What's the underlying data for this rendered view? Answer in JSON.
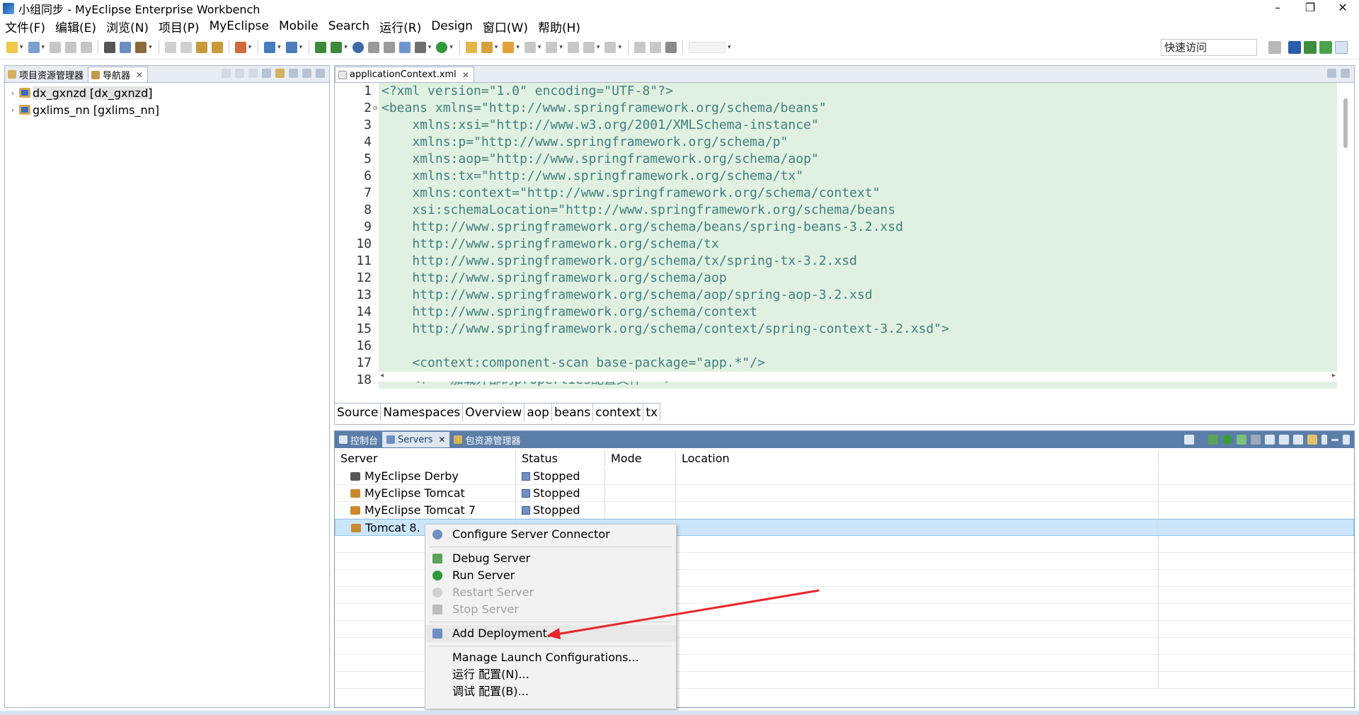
{
  "window": {
    "title": "小组同步 - MyEclipse Enterprise Workbench",
    "minimize": "–",
    "maximize": "❐",
    "close": "✕"
  },
  "menu": [
    "文件(F)",
    "编辑(E)",
    "浏览(N)",
    "项目(P)",
    "MyEclipse",
    "Mobile",
    "Search",
    "运行(R)",
    "Design",
    "窗口(W)",
    "帮助(H)"
  ],
  "toolbar": {
    "quick_access": "快速访问"
  },
  "left_panel": {
    "tabs": [
      {
        "label": "项目资源管理器",
        "active": false
      },
      {
        "label": "导航器",
        "active": true
      }
    ],
    "tree": [
      {
        "label": "dx_gxnzd [dx_gxnzd]",
        "selected": true
      },
      {
        "label": "gxlims_nn [gxlims_nn]",
        "selected": false
      }
    ]
  },
  "editor": {
    "tab": "applicationContext.xml",
    "lines": [
      {
        "n": "1",
        "text": "<?xml version=\"1.0\" encoding=\"UTF-8\"?>"
      },
      {
        "n": "2",
        "text": "<beans xmlns=\"http://www.springframework.org/schema/beans\""
      },
      {
        "n": "3",
        "text": "    xmlns:xsi=\"http://www.w3.org/2001/XMLSchema-instance\""
      },
      {
        "n": "4",
        "text": "    xmlns:p=\"http://www.springframework.org/schema/p\""
      },
      {
        "n": "5",
        "text": "    xmlns:aop=\"http://www.springframework.org/schema/aop\""
      },
      {
        "n": "6",
        "text": "    xmlns:tx=\"http://www.springframework.org/schema/tx\""
      },
      {
        "n": "7",
        "text": "    xmlns:context=\"http://www.springframework.org/schema/context\""
      },
      {
        "n": "8",
        "text": "    xsi:schemaLocation=\"http://www.springframework.org/schema/beans"
      },
      {
        "n": "9",
        "text": "    http://www.springframework.org/schema/beans/spring-beans-3.2.xsd"
      },
      {
        "n": "10",
        "text": "    http://www.springframework.org/schema/tx"
      },
      {
        "n": "11",
        "text": "    http://www.springframework.org/schema/tx/spring-tx-3.2.xsd"
      },
      {
        "n": "12",
        "text": "    http://www.springframework.org/schema/aop"
      },
      {
        "n": "13",
        "text": "    http://www.springframework.org/schema/aop/spring-aop-3.2.xsd"
      },
      {
        "n": "14",
        "text": "    http://www.springframework.org/schema/context"
      },
      {
        "n": "15",
        "text": "    http://www.springframework.org/schema/context/spring-context-3.2.xsd\">"
      },
      {
        "n": "16",
        "text": ""
      },
      {
        "n": "17",
        "text": "    <context:component-scan base-package=\"app.*\"/>"
      },
      {
        "n": "18",
        "text": "    <!-- 加载外部的properties配置文件 -->"
      }
    ],
    "bottom_tabs": [
      "Source",
      "Namespaces",
      "Overview",
      "aop",
      "beans",
      "context",
      "tx"
    ]
  },
  "servers_panel": {
    "tabs": [
      {
        "label": "控制台",
        "active": false
      },
      {
        "label": "Servers",
        "active": true
      },
      {
        "label": "包资源管理器",
        "active": false
      }
    ],
    "columns": [
      "Server",
      "Status",
      "Mode",
      "Location"
    ],
    "rows": [
      {
        "server": "MyEclipse Derby",
        "status": "Stopped",
        "mode": "",
        "location": ""
      },
      {
        "server": "MyEclipse Tomcat",
        "status": "Stopped",
        "mode": "",
        "location": ""
      },
      {
        "server": "MyEclipse Tomcat 7",
        "status": "Stopped",
        "mode": "",
        "location": ""
      },
      {
        "server": "Tomcat  8.",
        "status": "",
        "mode": "",
        "location": ""
      }
    ]
  },
  "context_menu": {
    "items": [
      {
        "label": "Configure Server Connector",
        "enabled": true
      },
      {
        "label": "Debug Server",
        "enabled": true
      },
      {
        "label": "Run Server",
        "enabled": true
      },
      {
        "label": "Restart Server",
        "enabled": false
      },
      {
        "label": "Stop Server",
        "enabled": false
      },
      {
        "label": "Add Deployment...",
        "enabled": true,
        "hover": true
      },
      {
        "label": "Manage Launch Configurations...",
        "enabled": true
      },
      {
        "label": "运行 配置(N)...",
        "enabled": true
      },
      {
        "label": "调试 配置(B)...",
        "enabled": true
      }
    ]
  },
  "colors": {
    "annotation_arrow": "#e8262b",
    "editor_highlight": "#e1f1e1",
    "selection": "#cbe6fb",
    "servers_tab_bar": "#5b7ea8"
  }
}
